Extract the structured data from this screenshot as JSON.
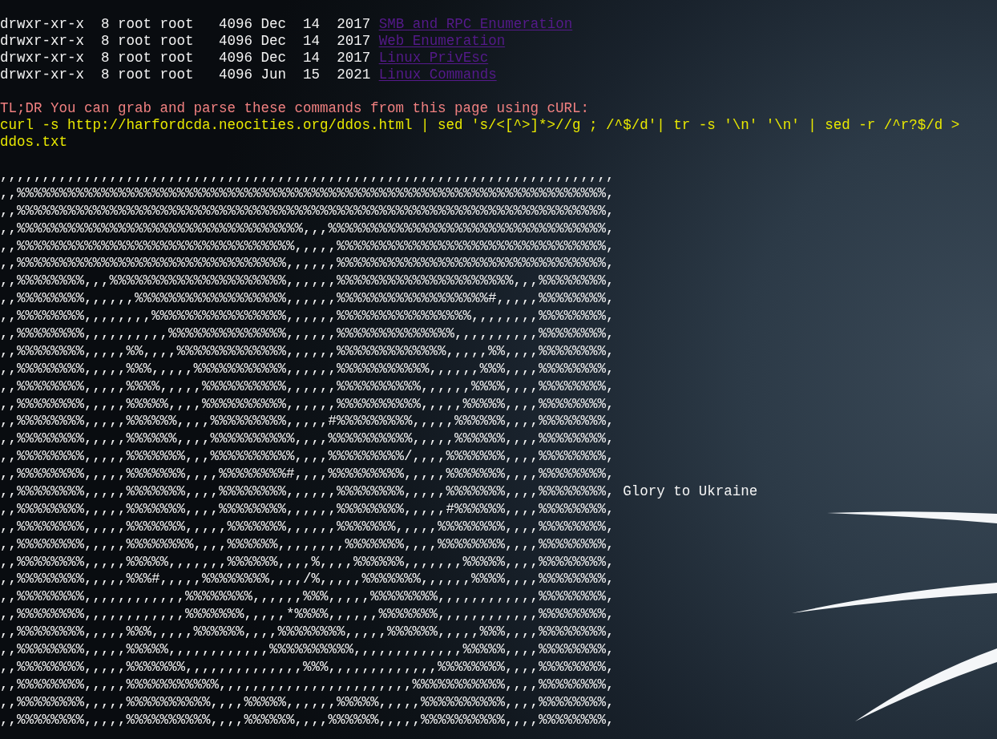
{
  "listing": [
    {
      "permissions": "drwxr-xr-x",
      "link_count": "8",
      "owner": "root",
      "group": "root",
      "size": "4096",
      "month": "Dec",
      "day": "14",
      "year": "2017",
      "name": "SMB and RPC Enumeration"
    },
    {
      "permissions": "drwxr-xr-x",
      "link_count": "8",
      "owner": "root",
      "group": "root",
      "size": "4096",
      "month": "Dec",
      "day": "14",
      "year": "2017",
      "name": "Web Enumeration"
    },
    {
      "permissions": "drwxr-xr-x",
      "link_count": "8",
      "owner": "root",
      "group": "root",
      "size": "4096",
      "month": "Dec",
      "day": "14",
      "year": "2017",
      "name": "Linux PrivEsc"
    },
    {
      "permissions": "drwxr-xr-x",
      "link_count": "8",
      "owner": "root",
      "group": "root",
      "size": "4096",
      "month": "Jun",
      "day": "15",
      "year": "2021",
      "name": "Linux Commands"
    }
  ],
  "note": "TL;DR You can grab and parse these commands from this page using cURL:",
  "command": "curl -s http://harfordcda.neocities.org/ddos.html | sed 's/<[^>]*>//g ; /^$/d'| tr -s '\\n' '\\n' | sed -r /^r?$/d > ddos.txt",
  "ascii_art": {
    "lines": [
      {
        "text": ",,,,,,,,,,,,,,,,,,,,,,,,,,,,,,,,,,,,,,,,,,,,,,,,,,,,,,,,,,,,,,,,,,,,,,,,,"
      },
      {
        "text": ",,%%%%%%%%%%%%%%%%%%%%%%%%%%%%%%%%%%%%%%%%%%%%%%%%%%%%%%%%%%%%%%%%%%%%%%,"
      },
      {
        "text": ",,%%%%%%%%%%%%%%%%%%%%%%%%%%%%%%%%%%%%%%%%%%%%%%%%%%%%%%%%%%%%%%%%%%%%%%,"
      },
      {
        "text": ",,%%%%%%%%%%%%%%%%%%%%%%%%%%%%%%%%%%,,,%%%%%%%%%%%%%%%%%%%%%%%%%%%%%%%%%,"
      },
      {
        "text": ",,%%%%%%%%%%%%%%%%%%%%%%%%%%%%%%%%%,,,,,%%%%%%%%%%%%%%%%%%%%%%%%%%%%%%%%,"
      },
      {
        "text": ",,%%%%%%%%%%%%%%%%%%%%%%%%%%%%%%%%,,,,,,%%%%%%%%%%%%%%%%%%%%%%%%%%%%%%%%,"
      },
      {
        "text": ",,%%%%%%%%,,,%%%%%%%%%%%%%%%%%%%%%,,,,,,%%%%%%%%%%%%%%%%%%%%%,,,%%%%%%%%,"
      },
      {
        "text": ",,%%%%%%%%,,,,,,%%%%%%%%%%%%%%%%%%,,,,,,%%%%%%%%%%%%%%%%%%#,,,,,%%%%%%%%,"
      },
      {
        "text": ",,%%%%%%%%,,,,,,,,%%%%%%%%%%%%%%%%,,,,,,%%%%%%%%%%%%%%%%,,,,,,,,%%%%%%%%,"
      },
      {
        "text": ",,%%%%%%%%,,,,,,,,,,%%%%%%%%%%%%%%,,,,,,%%%%%%%%%%%%%%,,,,,,,,,,%%%%%%%%,"
      },
      {
        "text": ",,%%%%%%%%,,,,,%%,,,,%%%%%%%%%%%%%,,,,,,%%%%%%%%%%%%%,,,,,%%,,,,%%%%%%%%,"
      },
      {
        "text": ",,%%%%%%%%,,,,,%%%,,,,,%%%%%%%%%%%,,,,,,%%%%%%%%%%%,,,,,,%%%,,,,%%%%%%%%,"
      },
      {
        "text": ",,%%%%%%%%,,,,,%%%%,,,,,%%%%%%%%%%,,,,,,%%%%%%%%%%,,,,,,%%%%,,,,%%%%%%%%,"
      },
      {
        "text": ",,%%%%%%%%,,,,,%%%%%,,,,%%%%%%%%%%,,,,,,%%%%%%%%%%,,,,,%%%%%,,,,%%%%%%%%,"
      },
      {
        "text": ",,%%%%%%%%,,,,,%%%%%%,,,,%%%%%%%%%,,,,,#%%%%%%%%%,,,,,%%%%%%,,,,%%%%%%%%,"
      },
      {
        "text": ",,%%%%%%%%,,,,,%%%%%%,,,,%%%%%%%%%%,,,,%%%%%%%%%%,,,,,%%%%%%,,,,%%%%%%%%,"
      },
      {
        "text": ",,%%%%%%%%,,,,,%%%%%%%,,,%%%%%%%%%%,,,,%%%%%%%%%/,,,,%%%%%%%,,,,%%%%%%%%,"
      },
      {
        "text": ",,%%%%%%%%,,,,,%%%%%%%,,,,%%%%%%%%#,,,,%%%%%%%%%,,,,,%%%%%%%,,,,%%%%%%%%,"
      },
      {
        "text": ",,%%%%%%%%,,,,,%%%%%%%,,,,%%%%%%%%,,,,,,%%%%%%%%,,,,,%%%%%%%,,,,%%%%%%%%,",
        "caption": "Glory to Ukraine"
      },
      {
        "text": ",,%%%%%%%%,,,,,%%%%%%%,,,,%%%%%%%%,,,,,,%%%%%%%%,,,,,#%%%%%%,,,,%%%%%%%%,"
      },
      {
        "text": ",,%%%%%%%%,,,,,%%%%%%%,,,,,%%%%%%%,,,,,,%%%%%%%,,,,,%%%%%%%%,,,,%%%%%%%%,"
      },
      {
        "text": ",,%%%%%%%%,,,,,%%%%%%%%,,,,%%%%%%,,,,,,,,%%%%%%%,,,,%%%%%%%%,,,,%%%%%%%%,"
      },
      {
        "text": ",,%%%%%%%%,,,,,%%%%%,,,,,,,%%%%%%,,,,%,,,,%%%%%%,,,,,,,%%%%%,,,,%%%%%%%%,"
      },
      {
        "text": ",,%%%%%%%%,,,,,%%%#,,,,,%%%%%%%%,,,,/%,,,,,%%%%%%%,,,,,,%%%%,,,,%%%%%%%%,"
      },
      {
        "text": ",,%%%%%%%%,,,,,,,,,,,,%%%%%%%%,,,,,,%%%,,,,,%%%%%%%%,,,,,,,,,,,,%%%%%%%%,"
      },
      {
        "text": ",,%%%%%%%%,,,,,,,,,,,,%%%%%%%,,,,,*%%%%,,,,,,%%%%%%%,,,,,,,,,,,,%%%%%%%%,"
      },
      {
        "text": ",,%%%%%%%%,,,,,%%%,,,,,%%%%%%,,,,%%%%%%%%,,,,,%%%%%%,,,,,%%%,,,,%%%%%%%%,"
      },
      {
        "text": ",,%%%%%%%%,,,,,%%%%%,,,,,,,,,,,,%%%%%%%%%%,,,,,,,,,,,,,%%%%%,,,,%%%%%%%%,"
      },
      {
        "text": ",,%%%%%%%%,,,,,%%%%%%%,,,,,,,,,,,,,,%%%,,,,,,,,,,,,,%%%%%%%%,,,,%%%%%%%%,"
      },
      {
        "text": ",,%%%%%%%%,,,,,%%%%%%%%%%%,,,,,,,,,,,,,,,,,,,,,,,%%%%%%%%%%%,,,,%%%%%%%%,"
      },
      {
        "text": ",,%%%%%%%%,,,,,%%%%%%%%%%,,,,%%%%%,,,,,,%%%%%,,,,,%%%%%%%%%%,,,,%%%%%%%%,"
      },
      {
        "text": ",,%%%%%%%%,,,,,%%%%%%%%%%,,,,%%%%%%,,,,%%%%%%,,,,,%%%%%%%%%%,,,,%%%%%%%%,"
      }
    ]
  }
}
